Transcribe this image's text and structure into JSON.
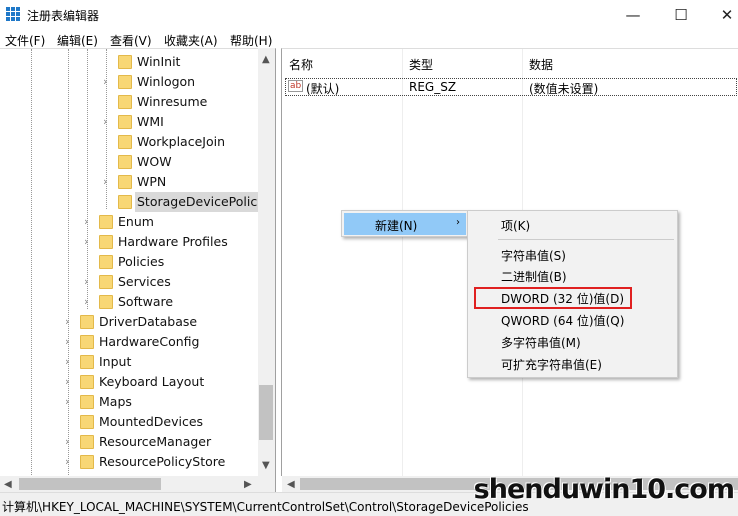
{
  "window": {
    "title": "注册表编辑器",
    "minimize": "—",
    "maximize": "☐",
    "close": "✕",
    "accent": "#1f78c8"
  },
  "menubar": [
    "文件(F)",
    "编辑(E)",
    "查看(V)",
    "收藏夹(A)",
    "帮助(H)"
  ],
  "tree": {
    "items": [
      {
        "label": "WinInit",
        "level": 3,
        "expandable": false
      },
      {
        "label": "Winlogon",
        "level": 3,
        "expandable": true
      },
      {
        "label": "Winresume",
        "level": 3,
        "expandable": false
      },
      {
        "label": "WMI",
        "level": 3,
        "expandable": true
      },
      {
        "label": "WorkplaceJoin",
        "level": 3,
        "expandable": false
      },
      {
        "label": "WOW",
        "level": 3,
        "expandable": false
      },
      {
        "label": "WPN",
        "level": 3,
        "expandable": true
      },
      {
        "label": "StorageDevicePolicie",
        "level": 3,
        "expandable": false,
        "selected": true
      },
      {
        "label": "Enum",
        "level": 2,
        "expandable": true
      },
      {
        "label": "Hardware Profiles",
        "level": 2,
        "expandable": true
      },
      {
        "label": "Policies",
        "level": 2,
        "expandable": false
      },
      {
        "label": "Services",
        "level": 2,
        "expandable": true
      },
      {
        "label": "Software",
        "level": 2,
        "expandable": true
      },
      {
        "label": "DriverDatabase",
        "level": 1,
        "expandable": true
      },
      {
        "label": "HardwareConfig",
        "level": 1,
        "expandable": true
      },
      {
        "label": "Input",
        "level": 1,
        "expandable": true
      },
      {
        "label": "Keyboard Layout",
        "level": 1,
        "expandable": true
      },
      {
        "label": "Maps",
        "level": 1,
        "expandable": true
      },
      {
        "label": "MountedDevices",
        "level": 1,
        "expandable": false
      },
      {
        "label": "ResourceManager",
        "level": 1,
        "expandable": true
      },
      {
        "label": "ResourcePolicyStore",
        "level": 1,
        "expandable": true
      }
    ]
  },
  "list": {
    "columns": [
      "名称",
      "类型",
      "数据"
    ],
    "rows": [
      {
        "icon": "ab",
        "name": "(默认)",
        "type": "REG_SZ",
        "data": "(数值未设置)"
      }
    ]
  },
  "context_menu": {
    "new_label": "新建(N)",
    "arrow": "›"
  },
  "submenu": {
    "items": [
      "项(K)",
      "字符串值(S)",
      "二进制值(B)",
      "DWORD (32 位)值(D)",
      "QWORD (64 位)值(Q)",
      "多字符串值(M)",
      "可扩充字符串值(E)"
    ],
    "highlight_color": "#e02020"
  },
  "status": {
    "path": "计算机\\HKEY_LOCAL_MACHINE\\SYSTEM\\CurrentControlSet\\Control\\StorageDevicePolicies"
  },
  "watermark": {
    "text": "shenduwin10.com"
  }
}
